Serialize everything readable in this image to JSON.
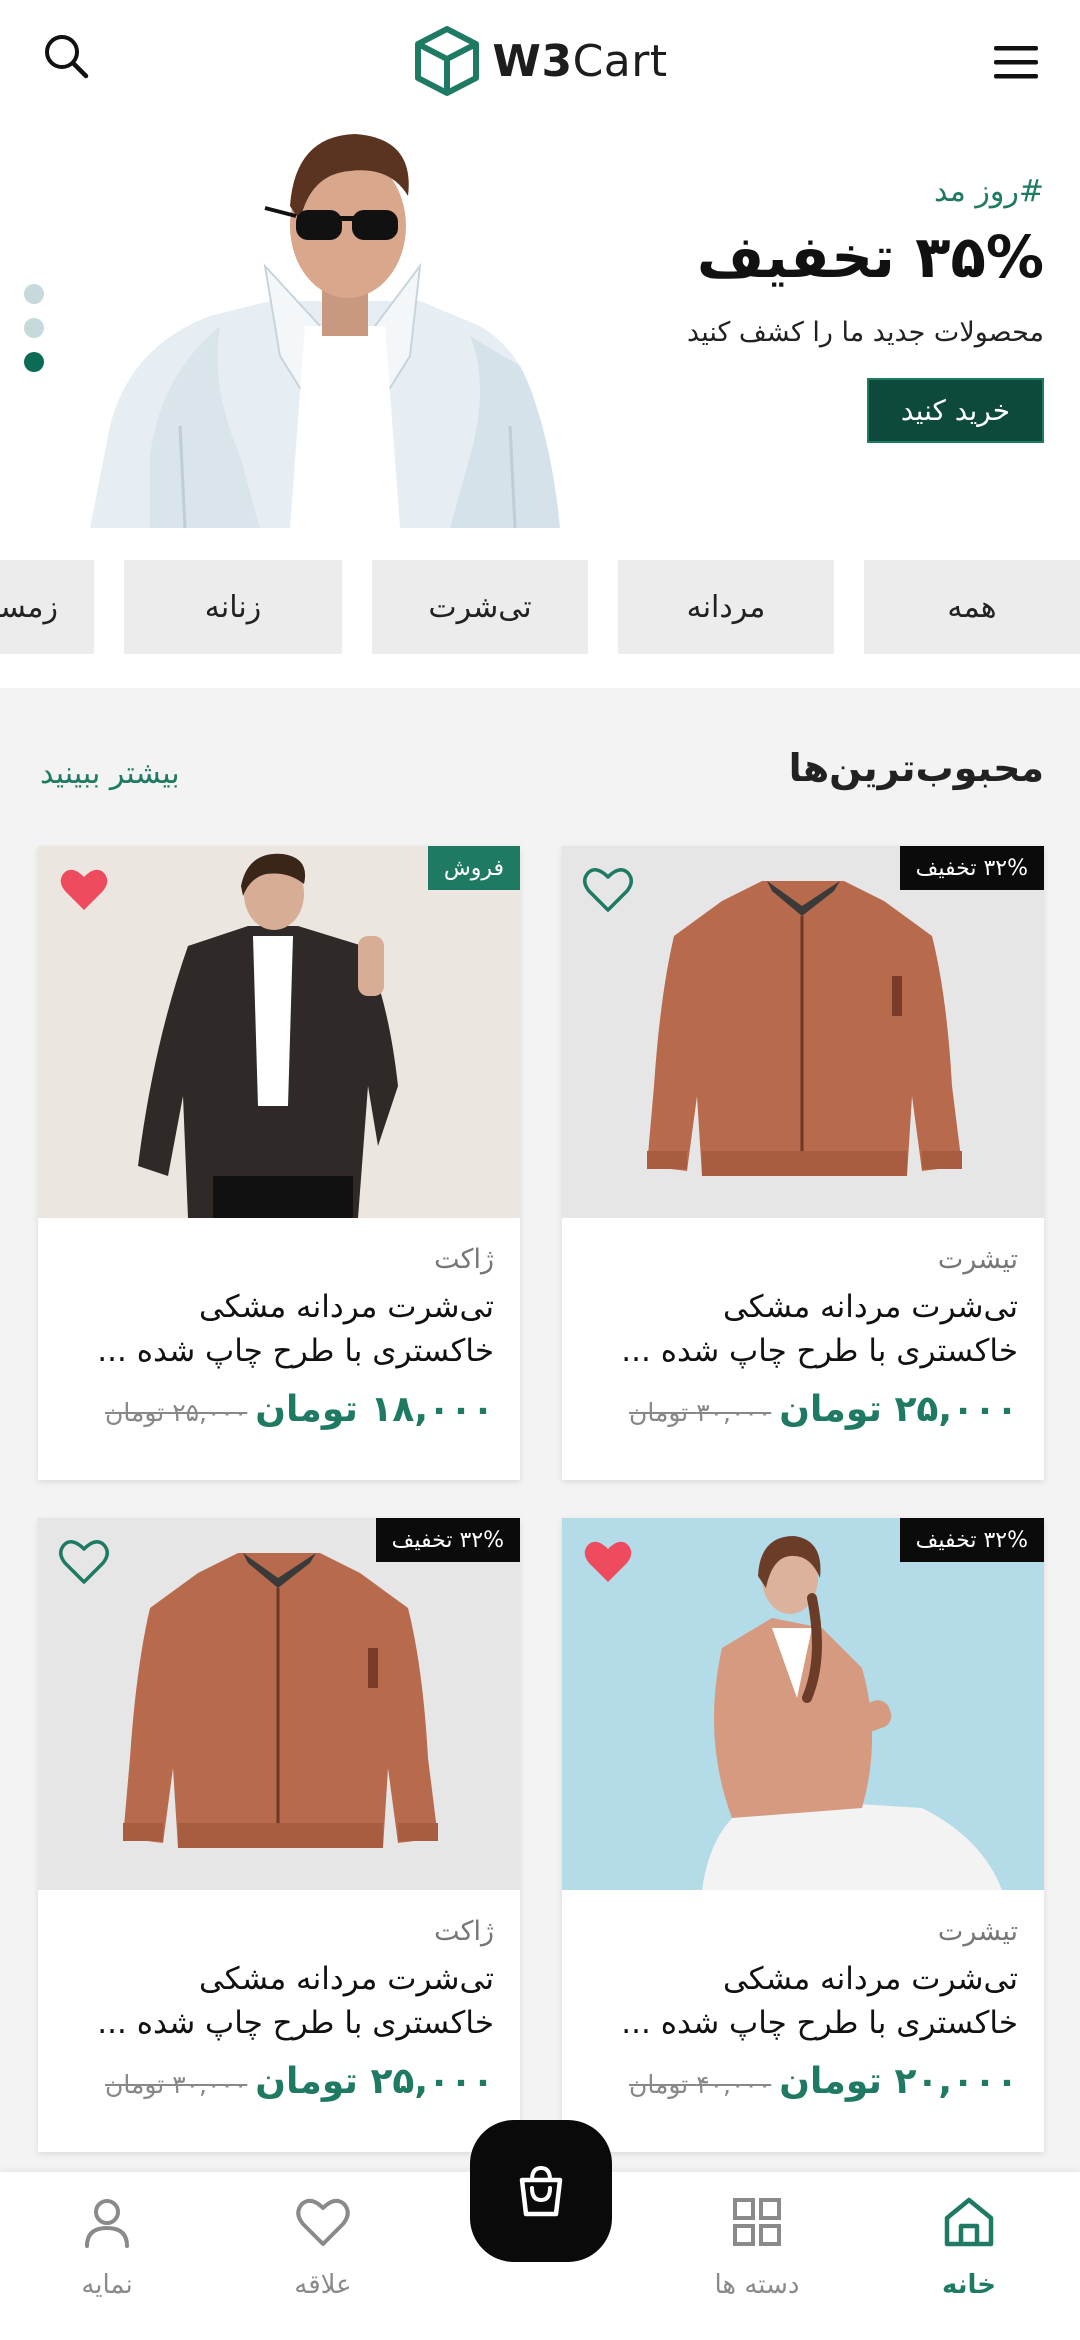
{
  "header": {
    "logo_bold": "W3",
    "logo_light": "Cart"
  },
  "banner": {
    "tag": "#روز مد",
    "headline": "۳۵% تخفیف",
    "subtitle": "محصولات جدید ما را کشف کنید",
    "button": "خرید کنید",
    "slides": 3,
    "active_slide": 3
  },
  "categories": [
    "همه",
    "مردانه",
    "تی‌شرت",
    "زنانه",
    "زمستانه"
  ],
  "section": {
    "title": "محبوب‌ترین‌ها",
    "more": "بیشتر ببینید"
  },
  "products": [
    {
      "badge": "۳۲% تخفیف",
      "badge_style": "black",
      "liked": false,
      "category": "تیشرت",
      "name_line1": "تی‌شرت مردانه مشکی",
      "name_line2": "خاکستری با طرح چاپ شده ...",
      "price": "۲۵,۰۰۰ تومان",
      "old_price": "۳۰,۰۰۰ تومان",
      "image": "rust-bomber-jacket"
    },
    {
      "badge": "فروش",
      "badge_style": "green",
      "liked": true,
      "category": "ژاکت",
      "name_line1": "تی‌شرت مردانه مشکی",
      "name_line2": "خاکستری با طرح چاپ شده ...",
      "price": "۱۸,۰۰۰ تومان",
      "old_price": "۲۵,۰۰۰ تومان",
      "image": "man-denim-jacket"
    },
    {
      "badge": "۳۲% تخفیف",
      "badge_style": "black",
      "liked": true,
      "category": "تیشرت",
      "name_line1": "تی‌شرت مردانه مشکی",
      "name_line2": "خاکستری با طرح چاپ شده ...",
      "price": "۲۰,۰۰۰ تومان",
      "old_price": "۴۰,۰۰۰ تومان",
      "image": "woman-leather-jacket"
    },
    {
      "badge": "۳۲% تخفیف",
      "badge_style": "black",
      "liked": false,
      "category": "ژاکت",
      "name_line1": "تی‌شرت مردانه مشکی",
      "name_line2": "خاکستری با طرح چاپ شده ...",
      "price": "۲۵,۰۰۰ تومان",
      "old_price": "۳۰,۰۰۰ تومان",
      "image": "rust-bomber-jacket"
    }
  ],
  "bottom_nav": {
    "home": "خانه",
    "categories": "دسته ها",
    "wishlist": "علاقه",
    "profile": "نمایه",
    "active": "home"
  },
  "colors": {
    "brand": "#1f7a63",
    "brand_dark": "#0d4a3b",
    "heart": "#ef4b5f"
  }
}
